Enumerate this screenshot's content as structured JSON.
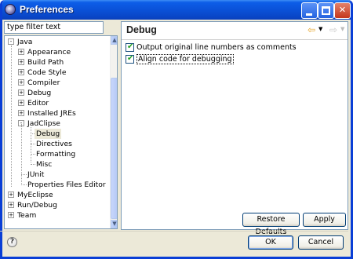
{
  "window": {
    "title": "Preferences"
  },
  "filter": {
    "placeholder": "type filter text"
  },
  "tree": {
    "items": [
      {
        "label": "Java",
        "exp": "-"
      },
      {
        "label": "Appearance",
        "exp": "+"
      },
      {
        "label": "Build Path",
        "exp": "+"
      },
      {
        "label": "Code Style",
        "exp": "+"
      },
      {
        "label": "Compiler",
        "exp": "+"
      },
      {
        "label": "Debug",
        "exp": "+"
      },
      {
        "label": "Editor",
        "exp": "+"
      },
      {
        "label": "Installed JREs",
        "exp": "+"
      },
      {
        "label": "JadClipse",
        "exp": "-"
      },
      {
        "label": "Debug",
        "exp": ""
      },
      {
        "label": "Directives",
        "exp": ""
      },
      {
        "label": "Formatting",
        "exp": ""
      },
      {
        "label": "Misc",
        "exp": ""
      },
      {
        "label": "JUnit",
        "exp": ""
      },
      {
        "label": "Properties Files Editor",
        "exp": ""
      },
      {
        "label": "MyEclipse",
        "exp": "+"
      },
      {
        "label": "Run/Debug",
        "exp": "+"
      },
      {
        "label": "Team",
        "exp": "+"
      }
    ]
  },
  "page": {
    "title": "Debug",
    "options": [
      {
        "label": "Output original line numbers as comments",
        "checked": true
      },
      {
        "label": "Align code for debugging",
        "checked": true
      }
    ]
  },
  "buttons": {
    "restore_defaults": "Restore Defaults",
    "apply": "Apply",
    "ok": "OK",
    "cancel": "Cancel"
  },
  "icons": {
    "help": "?",
    "back": "⇦",
    "forward": "⇨"
  }
}
